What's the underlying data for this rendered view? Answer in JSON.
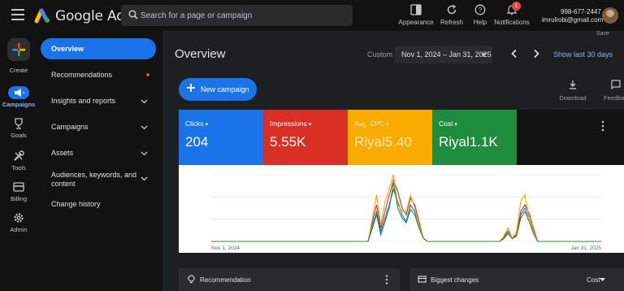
{
  "header": {
    "app_title": "Google Ads",
    "search_placeholder": "Search for a page or campaign",
    "buttons": [
      {
        "label": "Appearance",
        "icon": "appearance-icon"
      },
      {
        "label": "Refresh",
        "icon": "refresh-icon"
      },
      {
        "label": "Help",
        "icon": "help-icon"
      },
      {
        "label": "Notifications",
        "icon": "bell-icon"
      }
    ],
    "notification_count": "1",
    "account_phone": "998-677-2447",
    "account_email": "imrulrobi@gmail.com"
  },
  "rail": {
    "create_label": "Create",
    "items": [
      {
        "label": "Campaigns",
        "icon": "campaigns-icon",
        "active": true
      },
      {
        "label": "Goals",
        "icon": "trophy-icon"
      },
      {
        "label": "Tools",
        "icon": "tools-icon"
      },
      {
        "label": "Billing",
        "icon": "card-icon"
      },
      {
        "label": "Admin",
        "icon": "gear-icon"
      }
    ]
  },
  "nav": {
    "items": [
      {
        "label": "Overview",
        "active": true
      },
      {
        "label": "Recommendations",
        "dot": true
      },
      {
        "label": "Insights and reports",
        "expandable": true
      },
      {
        "label": "Campaigns",
        "expandable": true
      },
      {
        "label": "Assets",
        "expandable": true
      },
      {
        "label": "Audiences, keywords, and content",
        "expandable": true
      },
      {
        "label": "Change history"
      }
    ]
  },
  "main": {
    "save_label": "Save",
    "title": "Overview",
    "date_mode": "Custom",
    "date_range": "Nov 1, 2024 – Jan 31, 2025",
    "show_last_label": "Show last 30 days",
    "new_campaign_label": "New campaign",
    "download_label": "Download",
    "feedback_label": "Feedback",
    "metrics": [
      {
        "label": "Clicks",
        "value": "204",
        "color": "#1a73e8"
      },
      {
        "label": "Impressions",
        "value": "5.55K",
        "color": "#d93025"
      },
      {
        "label": "Avg. CPC",
        "value": "Riyal5.40",
        "color": "#f9ab00"
      },
      {
        "label": "Cost",
        "value": "Riyal1.1K",
        "color": "#1e8e3e"
      }
    ],
    "cards": [
      {
        "label": "Recommendation",
        "icon": "lightbulb-icon"
      },
      {
        "label": "Biggest changes",
        "icon": "changes-icon",
        "dropdown": "Cost"
      }
    ]
  },
  "chart_data": {
    "type": "line",
    "x_start_label": "Nov 1, 2024",
    "x_end_label": "Jan 31, 2025",
    "ylim": [
      0,
      1
    ],
    "grid": true,
    "series": [
      {
        "name": "Clicks",
        "color": "#1a73e8",
        "values": [
          0,
          0,
          0,
          0,
          0,
          0,
          0,
          0,
          0,
          0,
          0,
          0,
          0,
          0,
          0,
          0,
          0,
          0,
          0,
          0,
          0,
          0,
          0,
          0,
          0,
          0,
          0,
          0,
          0,
          0,
          0,
          0,
          0,
          0,
          0,
          0,
          0,
          0,
          0.25,
          0.45,
          0.15,
          0.35,
          0.55,
          0.78,
          0.6,
          0.4,
          0.3,
          0.55,
          0.45,
          0.25,
          0.05,
          0,
          0,
          0,
          0,
          0,
          0,
          0,
          0,
          0,
          0,
          0,
          0,
          0,
          0,
          0,
          0,
          0,
          0,
          0.05,
          0.15,
          0.05,
          0.1,
          0.4,
          0.5,
          0.35,
          0.15,
          0,
          0,
          0,
          0,
          0,
          0,
          0,
          0,
          0,
          0,
          0,
          0,
          0,
          0,
          0,
          0
        ]
      },
      {
        "name": "Impressions",
        "color": "#d93025",
        "values": [
          0,
          0,
          0,
          0,
          0,
          0,
          0,
          0,
          0,
          0,
          0,
          0,
          0,
          0,
          0,
          0,
          0,
          0,
          0,
          0,
          0,
          0,
          0,
          0,
          0,
          0,
          0,
          0,
          0,
          0,
          0,
          0,
          0,
          0,
          0,
          0,
          0,
          0,
          0.3,
          0.55,
          0.2,
          0.45,
          0.7,
          0.92,
          0.75,
          0.5,
          0.4,
          0.65,
          0.55,
          0.3,
          0.05,
          0,
          0,
          0,
          0,
          0,
          0,
          0,
          0,
          0,
          0,
          0,
          0,
          0,
          0,
          0,
          0,
          0,
          0,
          0.05,
          0.2,
          0.05,
          0.1,
          0.45,
          0.55,
          0.42,
          0.2,
          0,
          0,
          0,
          0,
          0,
          0,
          0,
          0,
          0,
          0,
          0,
          0,
          0,
          0,
          0,
          0
        ]
      },
      {
        "name": "Avg. CPC",
        "color": "#f9ab00",
        "values": [
          0,
          0,
          0,
          0,
          0,
          0,
          0,
          0,
          0,
          0,
          0,
          0,
          0,
          0,
          0,
          0,
          0,
          0,
          0,
          0,
          0,
          0,
          0,
          0,
          0,
          0,
          0,
          0,
          0,
          0,
          0,
          0,
          0,
          0,
          0,
          0,
          0,
          0,
          0.35,
          0.7,
          0.25,
          0.6,
          0.8,
          1.0,
          0.55,
          0.45,
          0.45,
          0.7,
          0.5,
          0.25,
          0.05,
          0,
          0,
          0,
          0,
          0,
          0,
          0,
          0,
          0,
          0,
          0,
          0,
          0,
          0,
          0,
          0,
          0,
          0,
          0.08,
          0.2,
          0.05,
          0.15,
          0.6,
          0.7,
          0.35,
          0.15,
          0,
          0,
          0,
          0,
          0,
          0,
          0,
          0,
          0,
          0,
          0,
          0,
          0,
          0,
          0,
          0
        ]
      },
      {
        "name": "Cost",
        "color": "#1e8e3e",
        "values": [
          0,
          0,
          0,
          0,
          0,
          0,
          0,
          0,
          0,
          0,
          0,
          0,
          0,
          0,
          0,
          0,
          0,
          0,
          0,
          0,
          0,
          0,
          0,
          0,
          0,
          0,
          0,
          0,
          0,
          0,
          0,
          0,
          0,
          0,
          0,
          0,
          0,
          0,
          0.2,
          0.4,
          0.1,
          0.3,
          0.5,
          0.88,
          0.5,
          0.35,
          0.28,
          0.48,
          0.4,
          0.2,
          0.05,
          0,
          0,
          0,
          0,
          0,
          0,
          0,
          0,
          0,
          0,
          0,
          0,
          0,
          0,
          0,
          0,
          0,
          0,
          0.04,
          0.12,
          0.04,
          0.08,
          0.35,
          0.45,
          0.3,
          0.12,
          0,
          0,
          0,
          0,
          0,
          0,
          0,
          0,
          0,
          0,
          0,
          0,
          0,
          0,
          0,
          0
        ]
      }
    ]
  }
}
